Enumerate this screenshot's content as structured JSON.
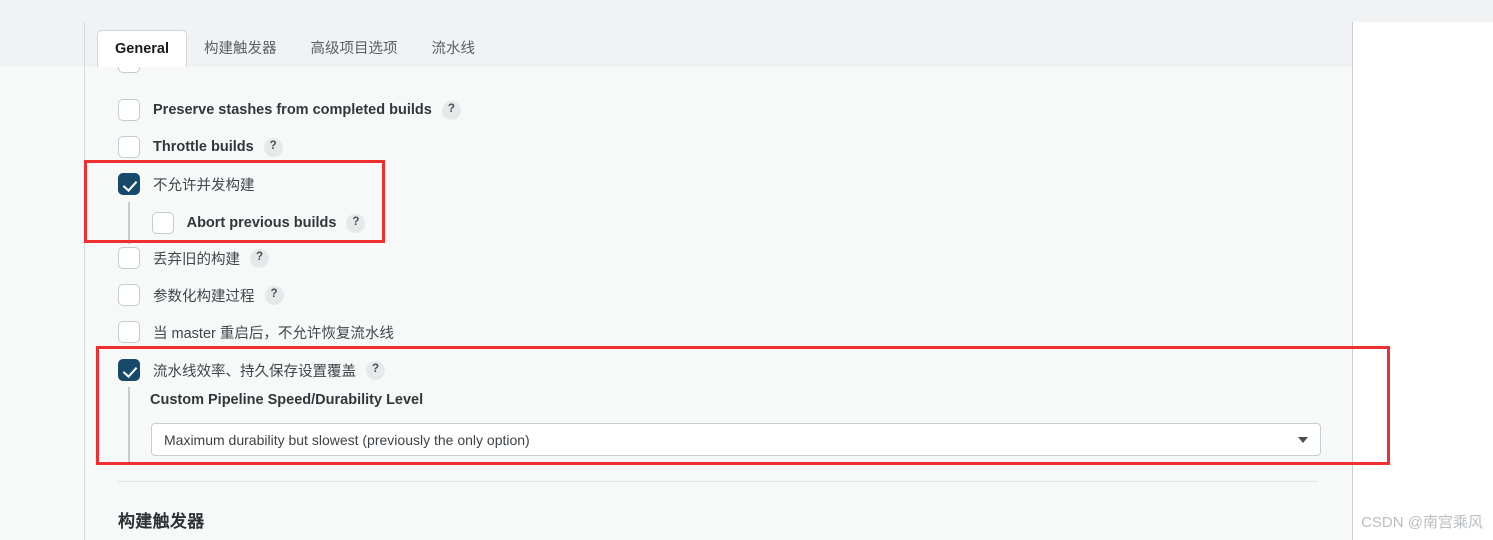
{
  "tabs": [
    {
      "label": "General",
      "active": true
    },
    {
      "label": "构建触发器",
      "active": false
    },
    {
      "label": "高级项目选项",
      "active": false
    },
    {
      "label": "流水线",
      "active": false
    }
  ],
  "options": [
    {
      "label": "Preserve stashes from completed builds",
      "checked": false,
      "help": "?",
      "lang": "en"
    },
    {
      "label": "Throttle builds",
      "checked": false,
      "help": "?",
      "lang": "en"
    },
    {
      "label": "不允许并发构建",
      "checked": true,
      "help": "",
      "lang": "cjk"
    },
    {
      "label": "Abort previous builds",
      "checked": false,
      "help": "?",
      "lang": "en",
      "nested": true
    },
    {
      "label": "丢弃旧的构建",
      "checked": false,
      "help": "?",
      "lang": "cjk"
    },
    {
      "label": "参数化构建过程",
      "checked": false,
      "help": "?",
      "lang": "cjk"
    },
    {
      "label": "当 master 重启后，不允许恢复流水线",
      "checked": false,
      "help": "",
      "lang": "cjk"
    },
    {
      "label": "流水线效率、持久保存设置覆盖",
      "checked": true,
      "help": "?",
      "lang": "cjk"
    }
  ],
  "durability": {
    "sublabel": "Custom Pipeline Speed/Durability Level",
    "selected": "Maximum durability but slowest (previously the only option)",
    "chevron_icon": "chevron-down-icon"
  },
  "section": {
    "heading": "构建触发器"
  },
  "watermark": {
    "text": "CSDN @南宫乘风"
  },
  "colors": {
    "checkbox_checked": "#17496b",
    "annotation_red": "#f03030",
    "panel_bg": "#f7f8f8",
    "tabbar_bg": "#f1f2f3"
  }
}
